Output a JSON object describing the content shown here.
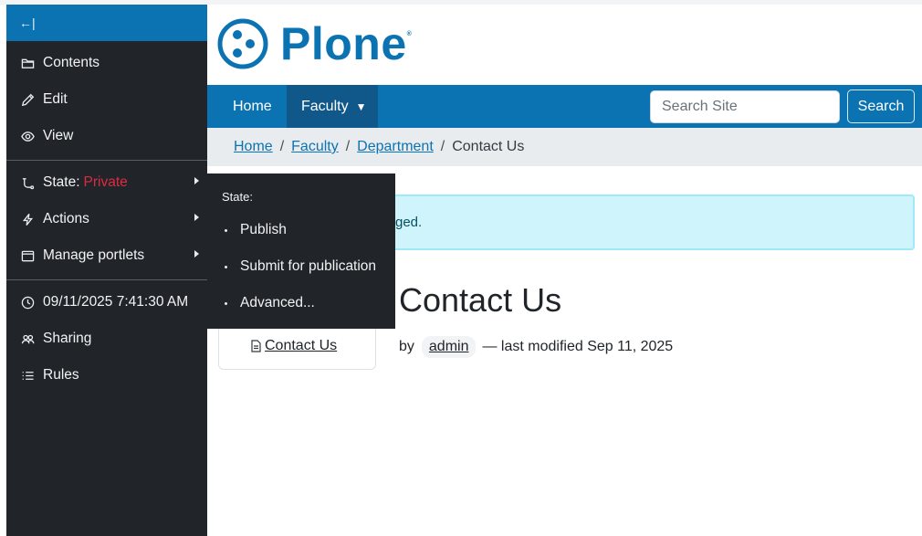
{
  "toolbar": {
    "collapse_glyph": "←|",
    "items_top": [
      {
        "label": "Contents",
        "icon": "folder-icon"
      },
      {
        "label": "Edit",
        "icon": "pencil-icon"
      },
      {
        "label": "View",
        "icon": "eye-icon"
      }
    ],
    "state": {
      "label": "State:",
      "value": "Private"
    },
    "actions_label": "Actions",
    "portlets_label": "Manage portlets",
    "datetime": "09/11/2025 7:41:30 AM",
    "sharing_label": "Sharing",
    "rules_label": "Rules",
    "colors": {
      "background": "#212529",
      "header": "#0c73b2",
      "state_private": "#dc2b43"
    }
  },
  "state_menu": {
    "title": "State:",
    "items": [
      "Publish",
      "Submit for publication",
      "Advanced..."
    ]
  },
  "logo": {
    "text": "Plone",
    "reg": "®",
    "color": "#0c73b2"
  },
  "nav": {
    "home": "Home",
    "faculty": "Faculty",
    "caret": "▼",
    "search_placeholder": "Search Site",
    "search_button": "Search"
  },
  "breadcrumb": {
    "items": [
      "Home",
      "Faculty",
      "Department"
    ],
    "separator": "/",
    "current": "Contact Us"
  },
  "alert": {
    "text": "ged."
  },
  "page": {
    "title": "Contact Us",
    "by": "by",
    "author": "admin",
    "modified": "— last modified Sep 11, 2025"
  },
  "portlet": {
    "link": "Contact Us"
  }
}
